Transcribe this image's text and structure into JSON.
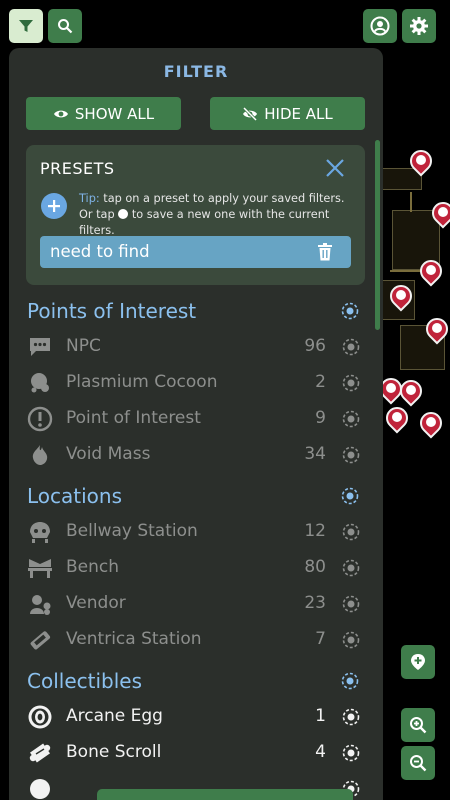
{
  "top": {
    "filter_icon": "filter-icon",
    "search_icon": "search-icon",
    "account_icon": "account-icon",
    "settings_icon": "gear-icon"
  },
  "panel": {
    "title": "FILTER",
    "show_all": "SHOW ALL",
    "hide_all": "HIDE ALL"
  },
  "presets": {
    "title": "PRESETS",
    "tip_label": "Tip:",
    "tip_text_1": " tap on a preset to apply your saved filters. Or tap ",
    "tip_text_2": " to save a new one with the current filters.",
    "items": [
      {
        "label": "need to find"
      }
    ]
  },
  "sections": [
    {
      "title": "Points of Interest",
      "items": [
        {
          "name": "NPC",
          "count": "96",
          "icon": "npc-icon"
        },
        {
          "name": "Plasmium Cocoon",
          "count": "2",
          "icon": "cocoon-icon"
        },
        {
          "name": "Point of Interest",
          "count": "9",
          "icon": "exclamation-icon"
        },
        {
          "name": "Void Mass",
          "count": "34",
          "icon": "void-mass-icon"
        }
      ]
    },
    {
      "title": "Locations",
      "items": [
        {
          "name": "Bellway Station",
          "count": "12",
          "icon": "bellway-icon"
        },
        {
          "name": "Bench",
          "count": "80",
          "icon": "bench-icon"
        },
        {
          "name": "Vendor",
          "count": "23",
          "icon": "vendor-icon"
        },
        {
          "name": "Ventrica Station",
          "count": "7",
          "icon": "ventrica-icon"
        }
      ]
    },
    {
      "title": "Collectibles",
      "items": [
        {
          "name": "Arcane Egg",
          "count": "1",
          "icon": "arcane-egg-icon"
        },
        {
          "name": "Bone Scroll",
          "count": "4",
          "icon": "bone-scroll-icon"
        }
      ]
    }
  ],
  "side": {
    "add_icon": "add-marker-icon",
    "zoom_in_icon": "zoom-in-icon",
    "zoom_out_icon": "zoom-out-icon"
  },
  "colors": {
    "accent_green": "#3f7d4b",
    "panel_bg": "#2b2f2b",
    "section_blue": "#8bc0ee",
    "pin_red": "#c0233a"
  }
}
